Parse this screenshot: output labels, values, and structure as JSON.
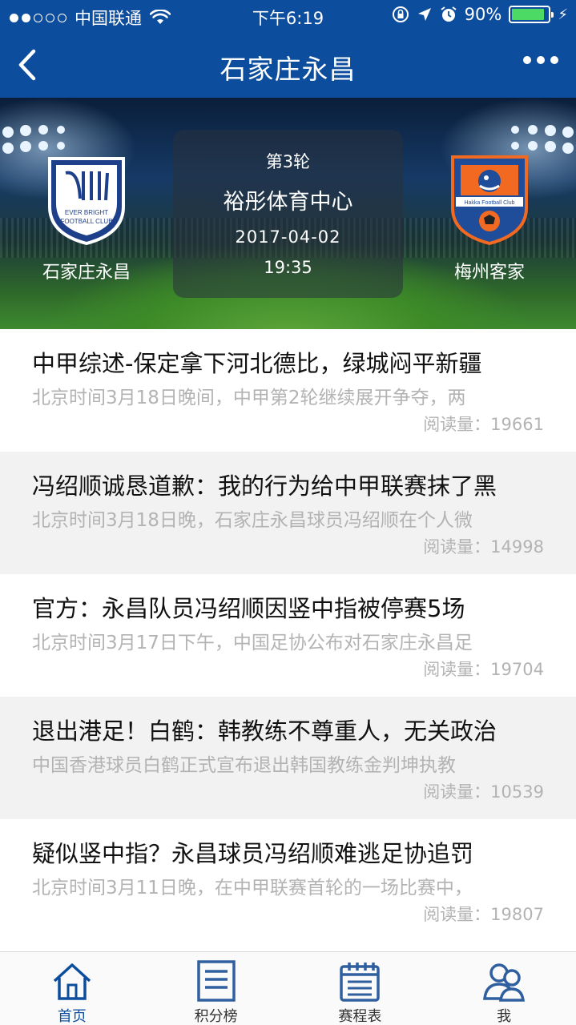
{
  "status_bar": {
    "carrier": "中国联通",
    "time": "下午6:19",
    "battery": "90%",
    "battery_level": 0.9
  },
  "nav": {
    "title": "石家庄永昌"
  },
  "match": {
    "round": "第3轮",
    "venue": "裕彤体育中心",
    "date": "2017-04-02",
    "time": "19:35",
    "home_team": "石家庄永昌",
    "away_team": "梅州客家",
    "home_logo_text": [
      "EVER BRIGHT",
      "FOOTBALL CLUB"
    ],
    "away_logo_text": "Hakka Football Club"
  },
  "news": [
    {
      "title": "中甲综述-保定拿下河北德比，绿城闷平新疆",
      "summary": "北京时间3月18日晚间，中甲第2轮继续展开争夺，两",
      "reads": "阅读量：19661"
    },
    {
      "title": "冯绍顺诚恳道歉：我的行为给中甲联赛抹了黑",
      "summary": "北京时间3月18日晚，石家庄永昌球员冯绍顺在个人微",
      "reads": "阅读量：14998"
    },
    {
      "title": "官方：永昌队员冯绍顺因竖中指被停赛5场",
      "summary": "北京时间3月17日下午，中国足协公布对石家庄永昌足",
      "reads": "阅读量：19704"
    },
    {
      "title": "退出港足！白鹤：韩教练不尊重人，无关政治",
      "summary": "中国香港球员白鹤正式宣布退出韩国教练金判坤执教",
      "reads": "阅读量：10539"
    },
    {
      "title": "疑似竖中指？永昌球员冯绍顺难逃足协追罚",
      "summary": "北京时间3月11日晚，在中甲联赛首轮的一场比赛中，",
      "reads": "阅读量：19807"
    }
  ],
  "tabs": [
    {
      "label": "首页",
      "icon": "home-icon",
      "active": true
    },
    {
      "label": "积分榜",
      "icon": "standings-icon",
      "active": false
    },
    {
      "label": "赛程表",
      "icon": "calendar-icon",
      "active": false
    },
    {
      "label": "我",
      "icon": "profile-icon",
      "active": false
    }
  ],
  "colors": {
    "brand_blue": "#0d4d9e",
    "battery_green": "#4cd964",
    "muted_text": "#b3b3b3"
  }
}
